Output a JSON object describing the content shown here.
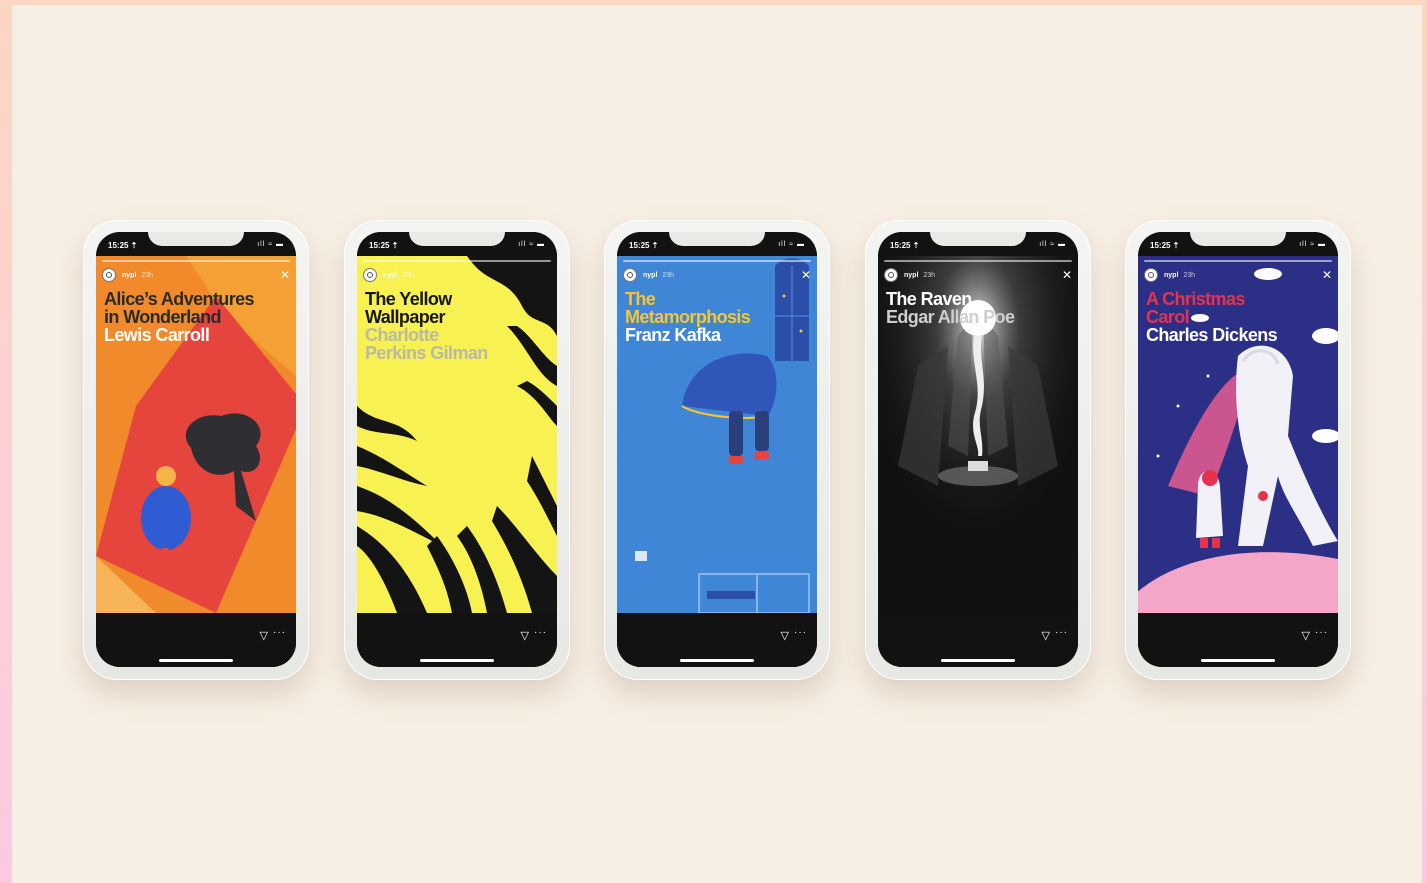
{
  "status_time": "15:25 ⇡",
  "status_icons": "ıll ≈ ▬",
  "phones": [
    {
      "handle": "nypl",
      "ago": "23h",
      "title_lines": [
        "Alice’s Adventures",
        "in Wonderland"
      ],
      "author_lines": [
        "Lewis Carroll"
      ],
      "title_color": "#2b2b2b",
      "author_color": "#ffffff",
      "bg": "#f08a2a"
    },
    {
      "handle": "nypl",
      "ago": "23h",
      "title_lines": [
        "The Yellow",
        "Wallpaper"
      ],
      "author_lines": [
        "Charlotte",
        "Perkins Gilman"
      ],
      "title_color": "#161616",
      "author_color": "#b9b9a8",
      "bg": "#f7f151"
    },
    {
      "handle": "nypl",
      "ago": "23h",
      "title_lines": [
        "The",
        "Metamorphosis"
      ],
      "author_lines": [
        "Franz Kafka"
      ],
      "title_color": "#f7c531",
      "author_color": "#ffffff",
      "bg": "#3f86d6"
    },
    {
      "handle": "nypl",
      "ago": "23h",
      "title_lines": [
        "The Raven"
      ],
      "author_lines": [
        "Edgar Allan Poe"
      ],
      "title_color": "#ffffff",
      "author_color": "#cfcfcf",
      "bg": "#111111"
    },
    {
      "handle": "nypl",
      "ago": "23h",
      "title_lines": [
        "A Christmas",
        "Carol"
      ],
      "author_lines": [
        "Charles Dickens"
      ],
      "title_color": "#e8324d",
      "author_color": "#ffffff",
      "bg": "#2b2f86"
    }
  ],
  "icons": {
    "send": "send-icon",
    "more": "more-icon",
    "close": "close-icon",
    "avatar": "nypl-logo-icon"
  }
}
